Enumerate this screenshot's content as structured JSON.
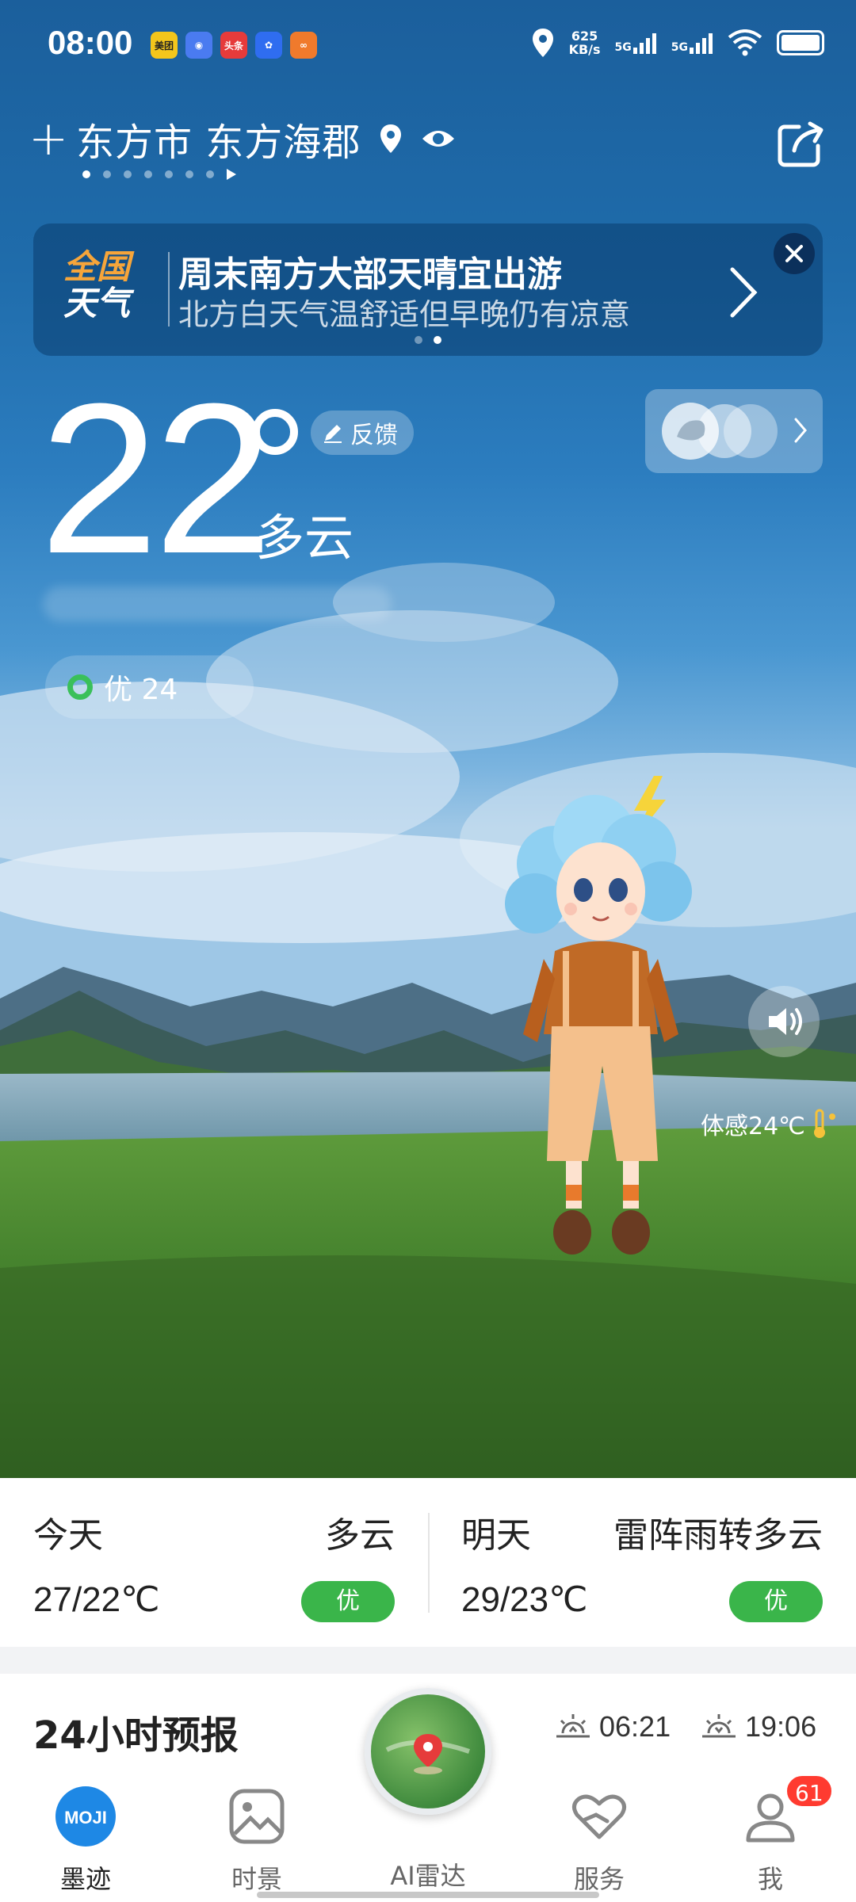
{
  "status_bar": {
    "time": "08:00",
    "net_speed_value": "625",
    "net_speed_unit": "KB/s",
    "sim1": "5G",
    "sim2": "5G",
    "notif_icons": [
      "meituan-icon",
      "app-icon",
      "toutiao-icon",
      "baidu-icon",
      "app-orange-icon"
    ],
    "notif_1": "美团",
    "notif_3": "头条"
  },
  "header": {
    "add_label": "+",
    "city": "东方市 东方海郡",
    "pages": 8,
    "active_page": 0
  },
  "banner": {
    "logo_line1": "全国",
    "logo_line2": "天气",
    "title": "周末南方大部天晴宜出游",
    "subtitle": "北方白天气温舒适但早晚仍有凉意",
    "pages": 2,
    "active_page": 1
  },
  "current": {
    "temperature": "22",
    "condition": "多云",
    "feedback_label": "反馈",
    "aqi_label": "优 24",
    "feels_like": "体感24℃"
  },
  "daily": {
    "today": {
      "label": "今天",
      "condition": "多云",
      "temp": "27/22℃",
      "aqi": "优"
    },
    "tomorrow": {
      "label": "明天",
      "condition": "雷阵雨转多云",
      "temp": "29/23℃",
      "aqi": "优"
    }
  },
  "hourly": {
    "title": "24小时预报",
    "sunrise": "06:21",
    "sunset": "19:06"
  },
  "nav": {
    "items": [
      {
        "label": "墨迹",
        "icon": "moji-logo-icon",
        "active": true
      },
      {
        "label": "时景",
        "icon": "image-icon",
        "active": false
      },
      {
        "label": "AI雷达",
        "icon": "radar-icon",
        "active": false
      },
      {
        "label": "服务",
        "icon": "heart-hand-icon",
        "active": false
      },
      {
        "label": "我",
        "icon": "profile-icon",
        "active": false
      }
    ],
    "moji_logo_text": "MOJI",
    "badge_count": "61"
  },
  "colors": {
    "aqi_green": "#3ab54a",
    "banner_logo_orange": "#f6a53a",
    "badge_red": "#ff3b30"
  }
}
